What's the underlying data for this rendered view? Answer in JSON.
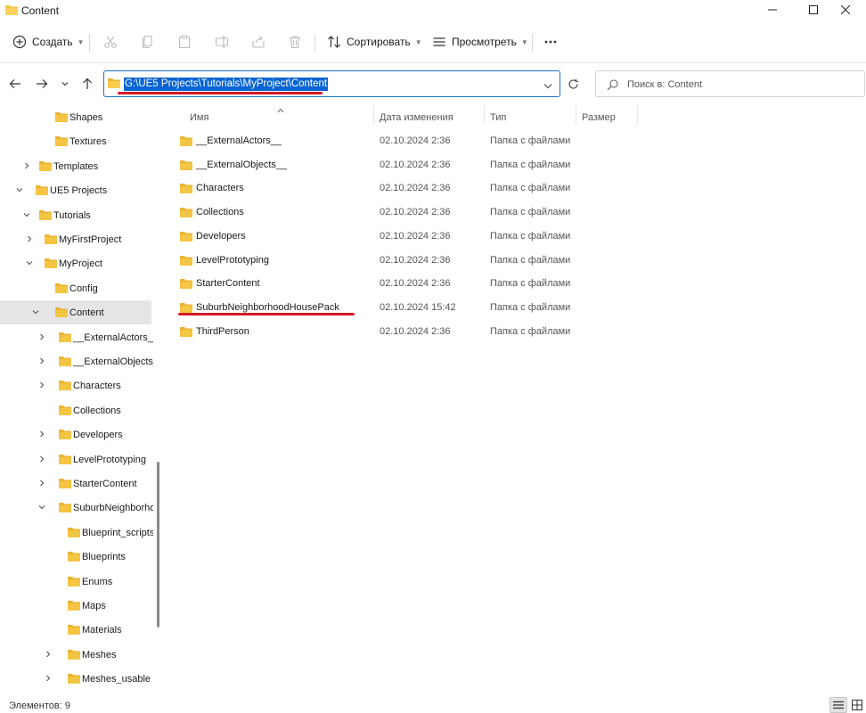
{
  "window": {
    "title": "Content"
  },
  "toolbar": {
    "create_label": "Создать",
    "sort_label": "Сортировать",
    "view_label": "Просмотреть",
    "more_label": "···"
  },
  "nav": {
    "address": "G:\\UE5 Projects\\Tutorials\\MyProject\\Content",
    "search_placeholder": "Поиск в: Content"
  },
  "sidebar": {
    "items": [
      {
        "label": "Shapes",
        "level": 3,
        "chevron": "none"
      },
      {
        "label": "Textures",
        "level": 3,
        "chevron": "none"
      },
      {
        "label": "Templates",
        "level": 1,
        "chevron": "right"
      },
      {
        "label": "UE5 Projects",
        "level": 0,
        "chevron": "down"
      },
      {
        "label": "Tutorials",
        "level": 1,
        "chevron": "down"
      },
      {
        "label": "MyFirstProject",
        "level": 2,
        "chevron": "right"
      },
      {
        "label": "MyProject",
        "level": 2,
        "chevron": "down"
      },
      {
        "label": "Config",
        "level": 3,
        "chevron": "none"
      },
      {
        "label": "Content",
        "level": 3,
        "chevron": "down",
        "selected": true
      },
      {
        "label": "__ExternalActors__",
        "level": 4,
        "chevron": "right"
      },
      {
        "label": "__ExternalObjects__",
        "level": 4,
        "chevron": "right"
      },
      {
        "label": "Characters",
        "level": 4,
        "chevron": "right"
      },
      {
        "label": "Collections",
        "level": 4,
        "chevron": "none"
      },
      {
        "label": "Developers",
        "level": 4,
        "chevron": "right"
      },
      {
        "label": "LevelPrototyping",
        "level": 4,
        "chevron": "right"
      },
      {
        "label": "StarterContent",
        "level": 4,
        "chevron": "right"
      },
      {
        "label": "SuburbNeighborhoodHousePack",
        "level": 4,
        "chevron": "down"
      },
      {
        "label": "Blueprint_scripts",
        "level": 5,
        "chevron": "none"
      },
      {
        "label": "Blueprints",
        "level": 5,
        "chevron": "none"
      },
      {
        "label": "Enums",
        "level": 5,
        "chevron": "none"
      },
      {
        "label": "Maps",
        "level": 5,
        "chevron": "none"
      },
      {
        "label": "Materials",
        "level": 5,
        "chevron": "none"
      },
      {
        "label": "Meshes",
        "level": 5,
        "chevron": "right"
      },
      {
        "label": "Meshes_usable",
        "level": 5,
        "chevron": "right"
      }
    ]
  },
  "columns": {
    "name": "Имя",
    "date": "Дата изменения",
    "type": "Тип",
    "size": "Размер"
  },
  "files": [
    {
      "name": "__ExternalActors__",
      "date": "02.10.2024 2:36",
      "type": "Папка с файлами"
    },
    {
      "name": "__ExternalObjects__",
      "date": "02.10.2024 2:36",
      "type": "Папка с файлами"
    },
    {
      "name": "Characters",
      "date": "02.10.2024 2:36",
      "type": "Папка с файлами"
    },
    {
      "name": "Collections",
      "date": "02.10.2024 2:36",
      "type": "Папка с файлами"
    },
    {
      "name": "Developers",
      "date": "02.10.2024 2:36",
      "type": "Папка с файлами"
    },
    {
      "name": "LevelPrototyping",
      "date": "02.10.2024 2:36",
      "type": "Папка с файлами"
    },
    {
      "name": "StarterContent",
      "date": "02.10.2024 2:36",
      "type": "Папка с файлами"
    },
    {
      "name": "SuburbNeighborhoodHousePack",
      "date": "02.10.2024 15:42",
      "type": "Папка с файлами"
    },
    {
      "name": "ThirdPerson",
      "date": "02.10.2024 2:36",
      "type": "Папка с файлами"
    }
  ],
  "status": {
    "items_count": "Элементов: 9"
  },
  "colors": {
    "accent": "#0a64d3",
    "folder": "#f4c542",
    "annotation": "#d21a2a",
    "selected_bg": "#e5e5e5"
  }
}
